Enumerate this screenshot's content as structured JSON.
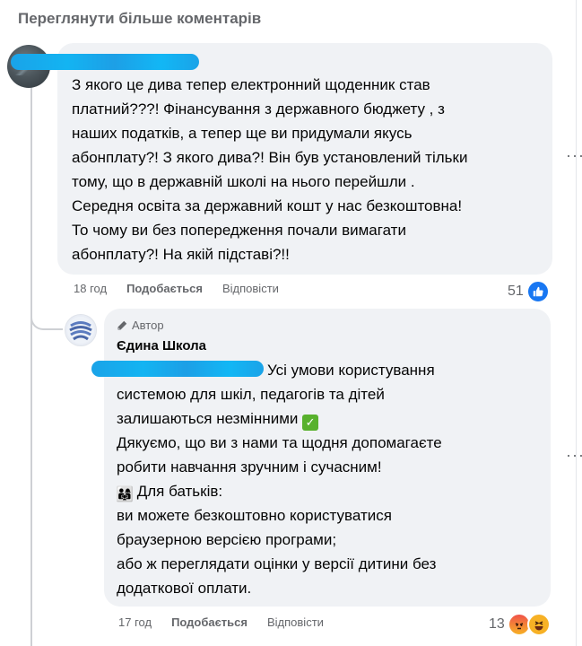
{
  "header": {
    "more_comments": "Переглянути більше коментарів"
  },
  "comment1": {
    "author": "",
    "text": "З якого це дива тепер електронний щоденник став\nплатний???! Фінансування з державного бюджету , з\nнаших податків, а тепер ще ви придумали якусь\nабонплату?! З якого дива?! Він був установлений тільки\nтому, що в державній школі на нього перейшли .\nСередня освіта за державний кошт у нас безкоштовна!\nТо чому ви без попередження почали вимагати\nабонплату?! На якій підставі?!!",
    "time": "18 год",
    "like": "Подобається",
    "reply": "Відповісти",
    "reaction_count": "51",
    "reaction_icons": [
      "like-icon"
    ]
  },
  "reply1": {
    "badge": "Автор",
    "author": "Єдина Школа",
    "line1": "Усі умови користування",
    "line2": "системою для шкіл, педагогів та дітей",
    "line3": "залишаються незмінними",
    "line4": "Дякуємо, що ви з нами та щодня допомагаєте",
    "line5": "робити навчання зручним і сучасним!",
    "line6": "Для батьків:",
    "line7": "ви можете безкоштовно користуватися",
    "line8": "браузерною версією програми;",
    "line9": "або ж переглядати оцінки у версії дитини без",
    "line10": "додаткової оплати.",
    "time": "17 год",
    "like": "Подобається",
    "reply": "Відповісти",
    "reaction_count": "13",
    "reaction_icons": [
      "angry-icon",
      "haha-icon"
    ]
  },
  "colors": {
    "accent": "#1877f2",
    "bubble": "#f0f2f5",
    "muted": "#65676b",
    "redaction": "#13b4f2"
  }
}
